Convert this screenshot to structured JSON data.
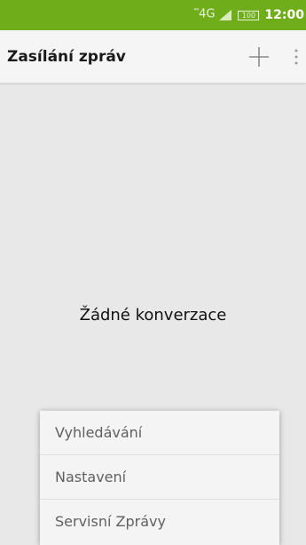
{
  "status_bar": {
    "network": "4G",
    "network_prefix": "⁴⁶",
    "battery": "100",
    "time": "12:00",
    "color": "#6fae1a"
  },
  "header": {
    "title": "Zasílání zpráv",
    "add_icon": "plus-icon",
    "more_icon": "overflow-menu-icon"
  },
  "main": {
    "empty_message": "Žádné konverzace"
  },
  "menu": {
    "items": [
      {
        "label": "Vyhledávání"
      },
      {
        "label": "Nastavení"
      },
      {
        "label": "Servisní Zprávy"
      }
    ]
  }
}
